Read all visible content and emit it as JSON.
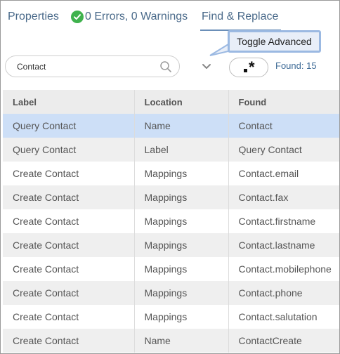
{
  "tabs": {
    "properties": "Properties",
    "errors": "0 Errors, 0 Warnings",
    "find_replace": "Find & Replace"
  },
  "tooltip": "Toggle Advanced",
  "search": {
    "value": "Contact",
    "placeholder": ""
  },
  "regex_icon": "regex-icon",
  "found": "Found: 15",
  "colors": {
    "accent": "#4a6a8a",
    "ok": "#3fb24d",
    "selected_row": "#cddff7"
  },
  "table": {
    "headers": [
      "Label",
      "Location",
      "Found"
    ],
    "rows": [
      [
        "Query Contact",
        "Name",
        "Contact"
      ],
      [
        "Query Contact",
        "Label",
        "Query Contact"
      ],
      [
        "Create Contact",
        "Mappings",
        "Contact.email"
      ],
      [
        "Create Contact",
        "Mappings",
        "Contact.fax"
      ],
      [
        "Create Contact",
        "Mappings",
        "Contact.firstname"
      ],
      [
        "Create Contact",
        "Mappings",
        "Contact.lastname"
      ],
      [
        "Create Contact",
        "Mappings",
        "Contact.mobilephone"
      ],
      [
        "Create Contact",
        "Mappings",
        "Contact.phone"
      ],
      [
        "Create Contact",
        "Mappings",
        "Contact.salutation"
      ],
      [
        "Create Contact",
        "Name",
        "ContactCreate"
      ]
    ]
  }
}
